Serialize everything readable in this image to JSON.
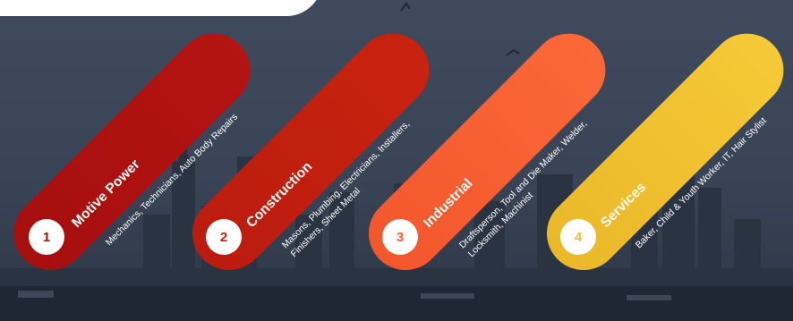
{
  "categories": [
    {
      "number": "1",
      "title": "Motive Power",
      "description": "Mechanics, Technicians, Auto Body Repairs",
      "color": "#a50f0e"
    },
    {
      "number": "2",
      "title": "Construction",
      "description": "Masons, Plumbing, Electricians, Installers, Finishers, Sheet Metal",
      "color": "#c0200f"
    },
    {
      "number": "3",
      "title": "Industrial",
      "description": "Draftsperson, Tool and Die Maker, Welder, Locksmith, Machinist",
      "color": "#f65f32"
    },
    {
      "number": "4",
      "title": "Services",
      "description": "Baker, Child & Youth Worker, IT, Hair Stylist",
      "color": "#f0c030"
    }
  ]
}
